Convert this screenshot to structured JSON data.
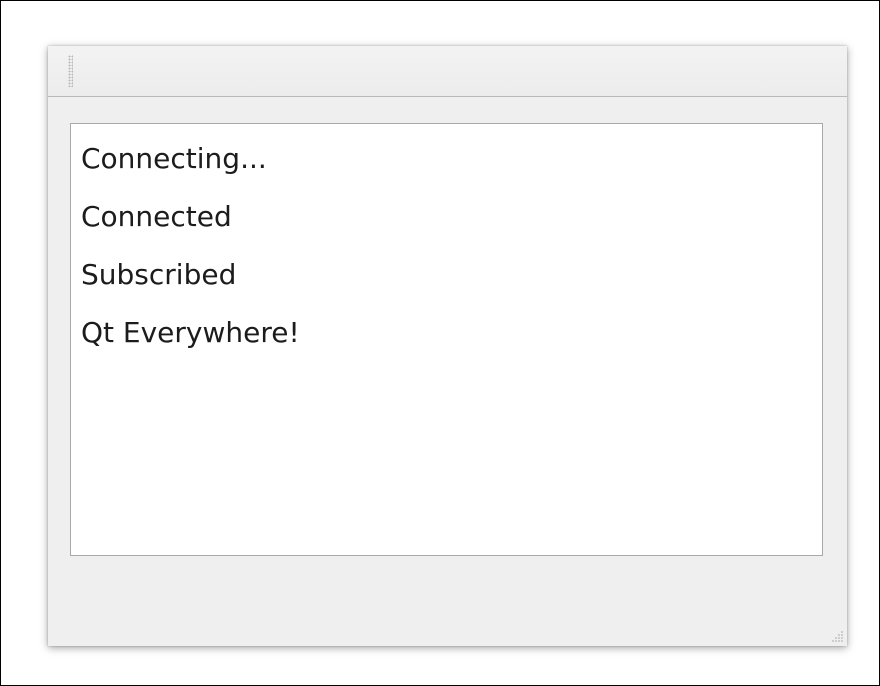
{
  "window": {
    "log_lines": [
      "Connecting...",
      "Connected",
      "Subscribed",
      "Qt Everywhere!"
    ]
  }
}
